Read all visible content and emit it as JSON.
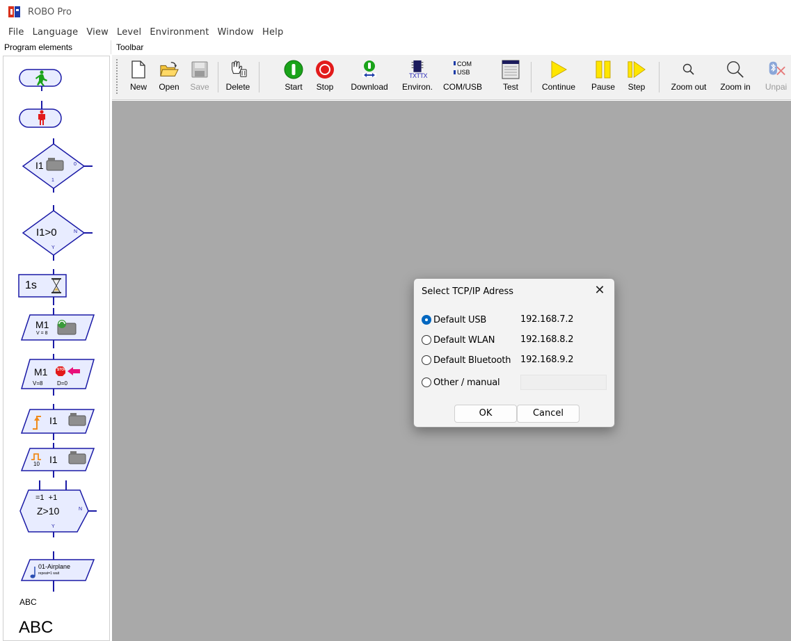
{
  "window": {
    "title": "ROBO Pro"
  },
  "menu": [
    "File",
    "Language",
    "View",
    "Level",
    "Environment",
    "Window",
    "Help"
  ],
  "panels": {
    "program_elements": "Program elements",
    "toolbar": "Toolbar"
  },
  "toolbar": {
    "new": "New",
    "open": "Open",
    "save": "Save",
    "delete": "Delete",
    "start": "Start",
    "stop": "Stop",
    "download": "Download",
    "environ": "Environ.",
    "comusb": "COM/USB",
    "test": "Test",
    "continue": "Continue",
    "pause": "Pause",
    "step": "Step",
    "zoom_out": "Zoom out",
    "zoom_in": "Zoom in",
    "unpair": "Unpai",
    "environ_icon_text": "TXTTX",
    "comusb_icon_com": "COM",
    "comusb_icon_usb": "USB"
  },
  "program_elements": {
    "branch_input": "I1",
    "branch_input_no": "0",
    "branch_input_yes": "1",
    "compare": "I1>0",
    "compare_no": "N",
    "compare_yes": "Y",
    "wait": "1s",
    "motor": "M1",
    "motor_speed": "V = 8",
    "motor_stop": "M1",
    "motor_stop_speed": "V=8",
    "motor_stop_d": "D=0",
    "stop_sign": "STOP",
    "wait_input": "I1",
    "pulse_count": "10",
    "pulse_input": "I1",
    "counter_top": "=1  +1",
    "counter_cond": "Z>10",
    "counter_no": "N",
    "counter_yes": "Y",
    "sound_name": "01-Airplane",
    "sound_sub": "repeat=1 wait",
    "text_small": "ABC",
    "text_large": "ABC"
  },
  "dialog": {
    "title": "Select TCP/IP Adress",
    "close": "✕",
    "options": [
      {
        "label": "Default USB",
        "ip": "192.168.7.2",
        "selected": true
      },
      {
        "label": "Default WLAN",
        "ip": "192.168.8.2",
        "selected": false
      },
      {
        "label": "Default Bluetooth",
        "ip": "192.168.9.2",
        "selected": false
      },
      {
        "label": "Other / manual",
        "ip": "",
        "selected": false
      }
    ],
    "ok": "OK",
    "cancel": "Cancel"
  },
  "colors": {
    "canvas": "#a9a9a9",
    "element_fill": "#e8ecff",
    "element_stroke": "#1a1aa6",
    "start_green": "#1aa31a",
    "stop_red": "#e21b1b",
    "accent_yellow": "#ffe600",
    "radio_blue": "#0067c0"
  }
}
